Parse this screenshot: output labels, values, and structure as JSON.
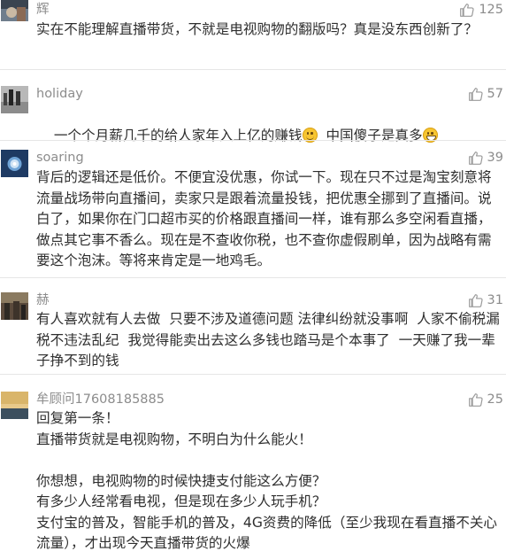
{
  "comments": [
    {
      "username": "辉",
      "likes": "125",
      "body": "实在不能理解直播带货，不就是电视购物的翻版吗？真是没东西创新了？"
    },
    {
      "username": "holiday",
      "likes": "57",
      "body_part1": "一个个月薪几千的给人家年入上亿的赚钱",
      "body_part2": "  中国傻子是真多",
      "emojis": [
        "smile-emoji",
        "grin-emoji"
      ]
    },
    {
      "username": "soaring",
      "likes": "39",
      "body": "背后的逻辑还是低价。不便宜没优惠，你试一下。现在只不过是淘宝刻意将流量战场带向直播间，卖家只是跟着流量投钱，把优惠全挪到了直播间。说白了，如果你在门口超市买的价格跟直播间一样，谁有那么多空闲看直播，做点其它事不香么。现在是不查收你税，也不查你虚假刷单，因为战略有需要这个泡沫。等将来肯定是一地鸡毛。"
    },
    {
      "username": "赫",
      "likes": "31",
      "body": "有人喜欢就有人去做  只要不涉及道德问题 法律纠纷就没事啊  人家不偷税漏税不违法乱纪  我觉得能卖出去这么多钱也踏马是个本事了  一天赚了我一辈子挣不到的钱"
    },
    {
      "username": "牟顾问17608185885",
      "likes": "25",
      "body": "回复第一条！\n直播带货就是电视购物，不明白为什么能火！\n\n你想想，电视购物的时候快捷支付能这么方便？\n有多少人经常看电视，但是现在多少人玩手机？\n支付宝的普及，智能手机的普及，4G资费的降低（至少我现在看直播不关心流量），才出现今天直播带货的火爆"
    }
  ],
  "icons": {
    "like": "thumbs-up-icon"
  },
  "colors": {
    "meta": "#8c8c8c",
    "text": "#2e2e2e",
    "divider": "#e6e6e6"
  }
}
